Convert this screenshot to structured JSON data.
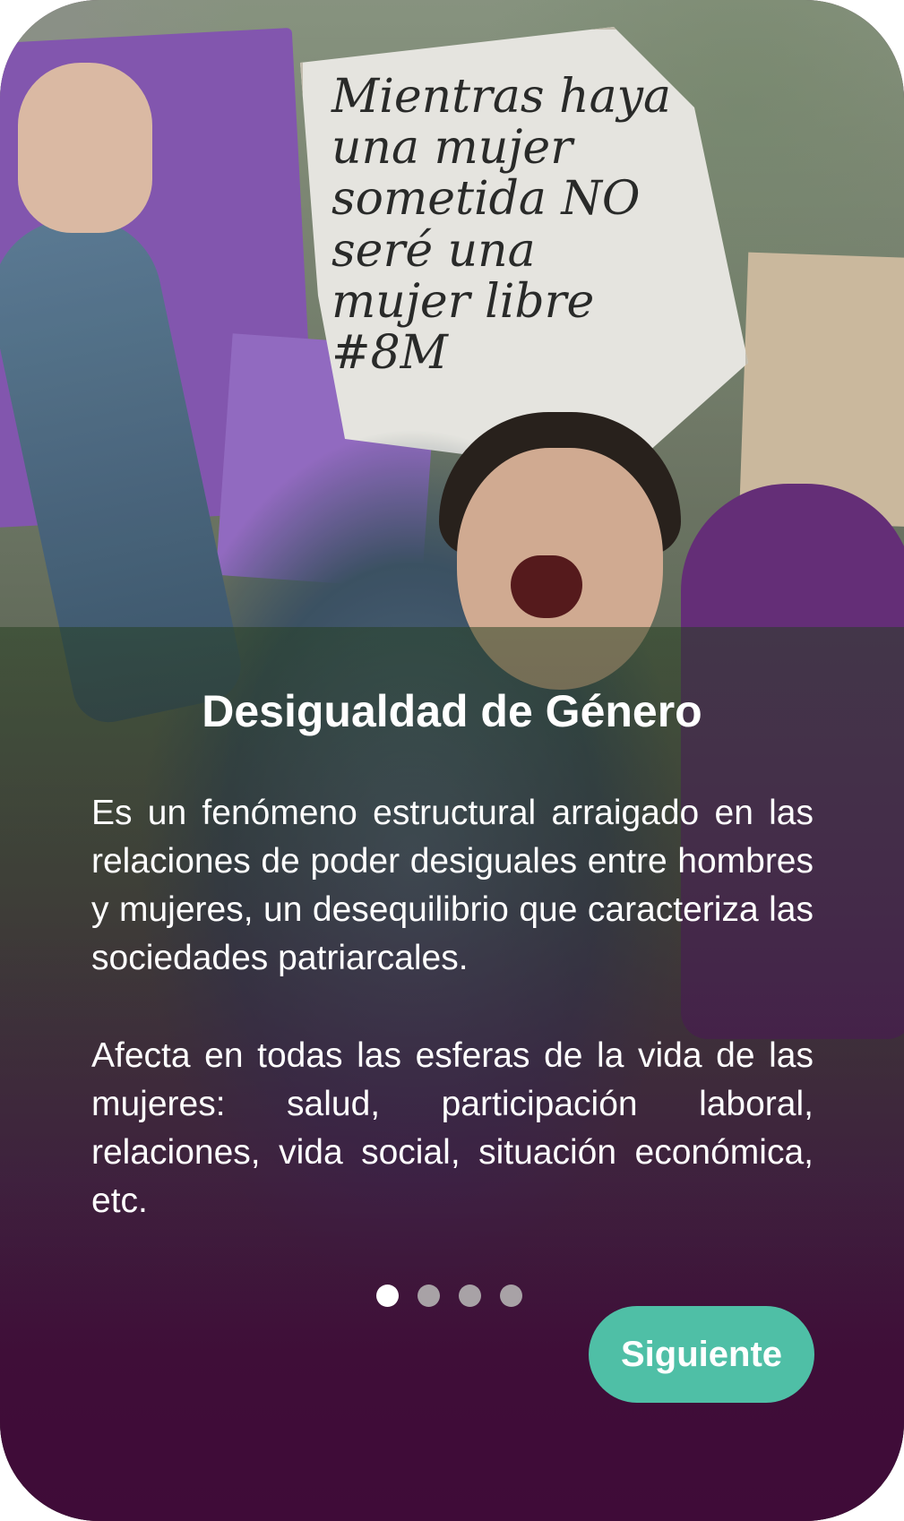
{
  "background": {
    "photo_sign_text": "Mientras haya una mujer sometida NO seré una mujer libre #8M"
  },
  "slide": {
    "title": "Desigualdad de Género",
    "paragraphs": [
      "Es un fenómeno estructural arraigado en las relaciones de poder desiguales entre hombres y mujeres, un desequilibrio que caracteriza las sociedades patriarcales.",
      "Afecta en todas las esferas de la vida de las mujeres: salud, participación laboral, relaciones, vida social, situación económica, etc."
    ]
  },
  "pagination": {
    "total": 4,
    "current": 1
  },
  "actions": {
    "next_label": "Siguiente"
  },
  "colors": {
    "accent": "#4fbfa6",
    "panel": "#3f0b38",
    "dot_active": "#ffffff",
    "dot_inactive": "#a8a2a6"
  }
}
